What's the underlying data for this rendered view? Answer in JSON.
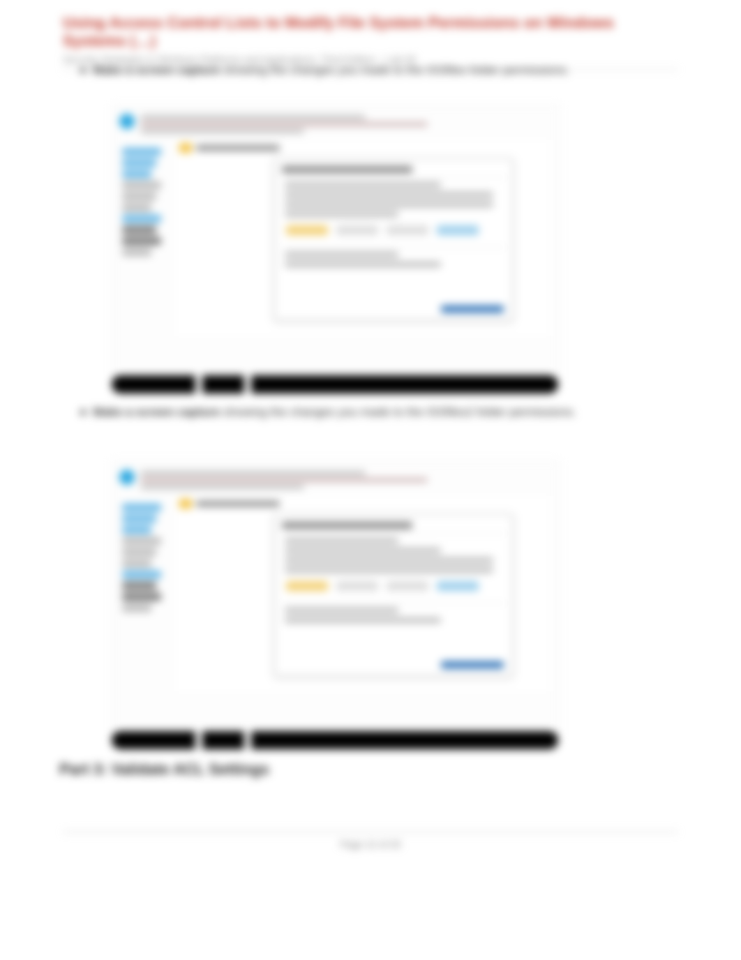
{
  "header": {
    "title": "Using Access Control Lists to Modify File System Permissions on Windows Systems (…)",
    "subtitle": "Security Strategies in Windows Platforms and Applications, Third Edition – Lab 05"
  },
  "bullets": [
    {
      "lead": "Make a screen capture",
      "rest": " showing the changes you made to the ISSfiles folder permissions."
    },
    {
      "lead": "Make a screen capture",
      "rest": " showing the changes you made to the ISSfiles2 folder permissions."
    }
  ],
  "screenshots": {
    "app": "File Explorer",
    "dialog": "Advanced Security / Permissions",
    "folders": [
      "ISSfiles",
      "ISSfiles2"
    ],
    "action_link": "Change permissions"
  },
  "part3": "Part 3: Validate ACL Settings",
  "footer": "Page 12 of 20"
}
